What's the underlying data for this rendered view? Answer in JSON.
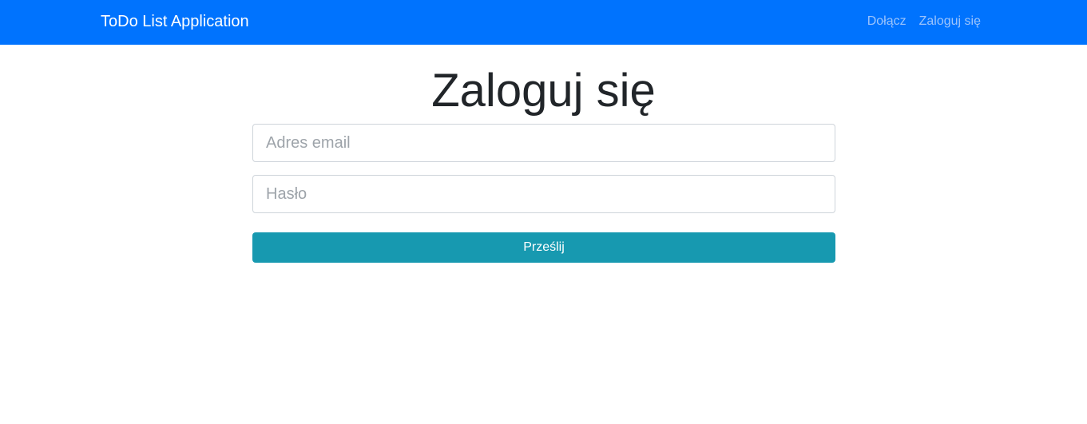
{
  "navbar": {
    "brand": "ToDo List Application",
    "links": [
      {
        "label": "Dołącz"
      },
      {
        "label": "Zaloguj się"
      }
    ]
  },
  "main": {
    "title": "Zaloguj się",
    "email": {
      "value": "",
      "placeholder": "Adres email"
    },
    "password": {
      "value": "",
      "placeholder": "Hasło"
    },
    "submit_label": "Prześlij"
  },
  "colors": {
    "navbar": "#0073fe",
    "button": "#1799b0"
  }
}
